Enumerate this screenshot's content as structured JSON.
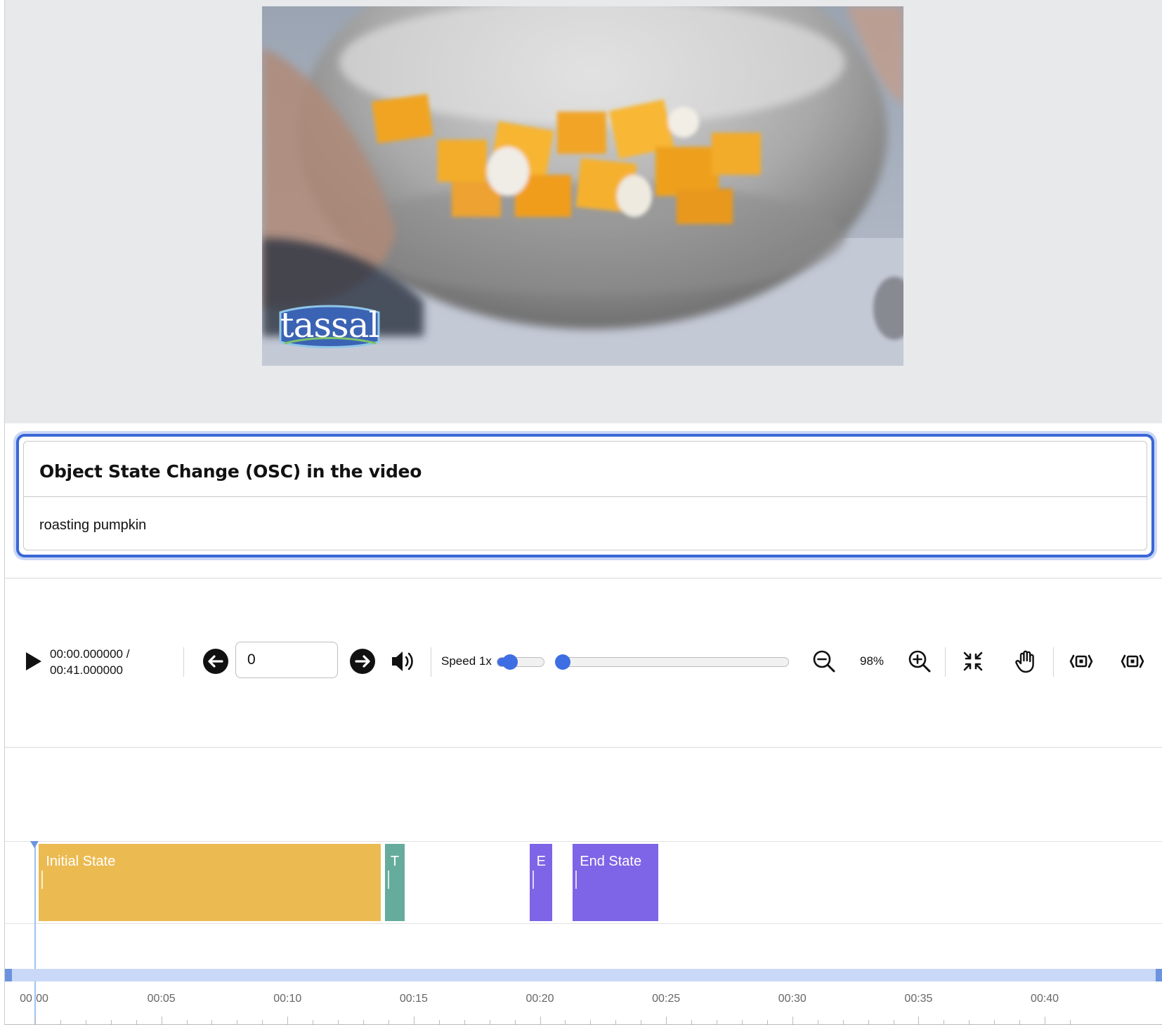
{
  "video": {
    "logo_text": "tassal"
  },
  "info_card": {
    "title": "Object State Change (OSC) in the video",
    "value": "roasting pumpkin"
  },
  "controls": {
    "time_current": "00:00.000000 /",
    "time_total": "00:41.000000",
    "frame_value": "0",
    "speed_label": "Speed 1x",
    "speed_level": 0.2,
    "seek_position": 0,
    "zoom_label": "98%",
    "icons": {
      "play": "play-icon",
      "prev_frame": "arrow-left-icon",
      "next_frame": "arrow-right-icon",
      "volume": "volume-icon",
      "zoom_out": "zoom-out-icon",
      "zoom_in": "zoom-in-icon",
      "fit": "collapse-icon",
      "pan": "hand-icon",
      "prev_segment": "segment-prev-icon",
      "next_segment": "segment-next-icon"
    }
  },
  "timeline": {
    "duration_seconds": 41,
    "current_seconds": 0,
    "segments": [
      {
        "label": "Initial State",
        "start": 0.15,
        "end": 13.7,
        "color": "#ebbb52"
      },
      {
        "label": "T",
        "start": 13.85,
        "end": 14.65,
        "color": "#66ac9d"
      },
      {
        "label": "E",
        "start": 19.6,
        "end": 20.5,
        "color": "#7e64e6"
      },
      {
        "label": "End State",
        "start": 21.3,
        "end": 24.7,
        "color": "#7e64e6"
      }
    ],
    "tick_labels": [
      "00:00",
      "00:05",
      "00:10",
      "00:15",
      "00:20",
      "00:25",
      "00:30",
      "00:35",
      "00:40"
    ],
    "tick_values": [
      0,
      5,
      10,
      15,
      20,
      25,
      30,
      35,
      40
    ],
    "ruler_origin_label": "00"
  },
  "colors": {
    "accent": "#3a67d6",
    "slider": "#3d6ee3",
    "initial_state": "#ebbb52",
    "transition": "#66ac9d",
    "end_state": "#7e64e6"
  }
}
